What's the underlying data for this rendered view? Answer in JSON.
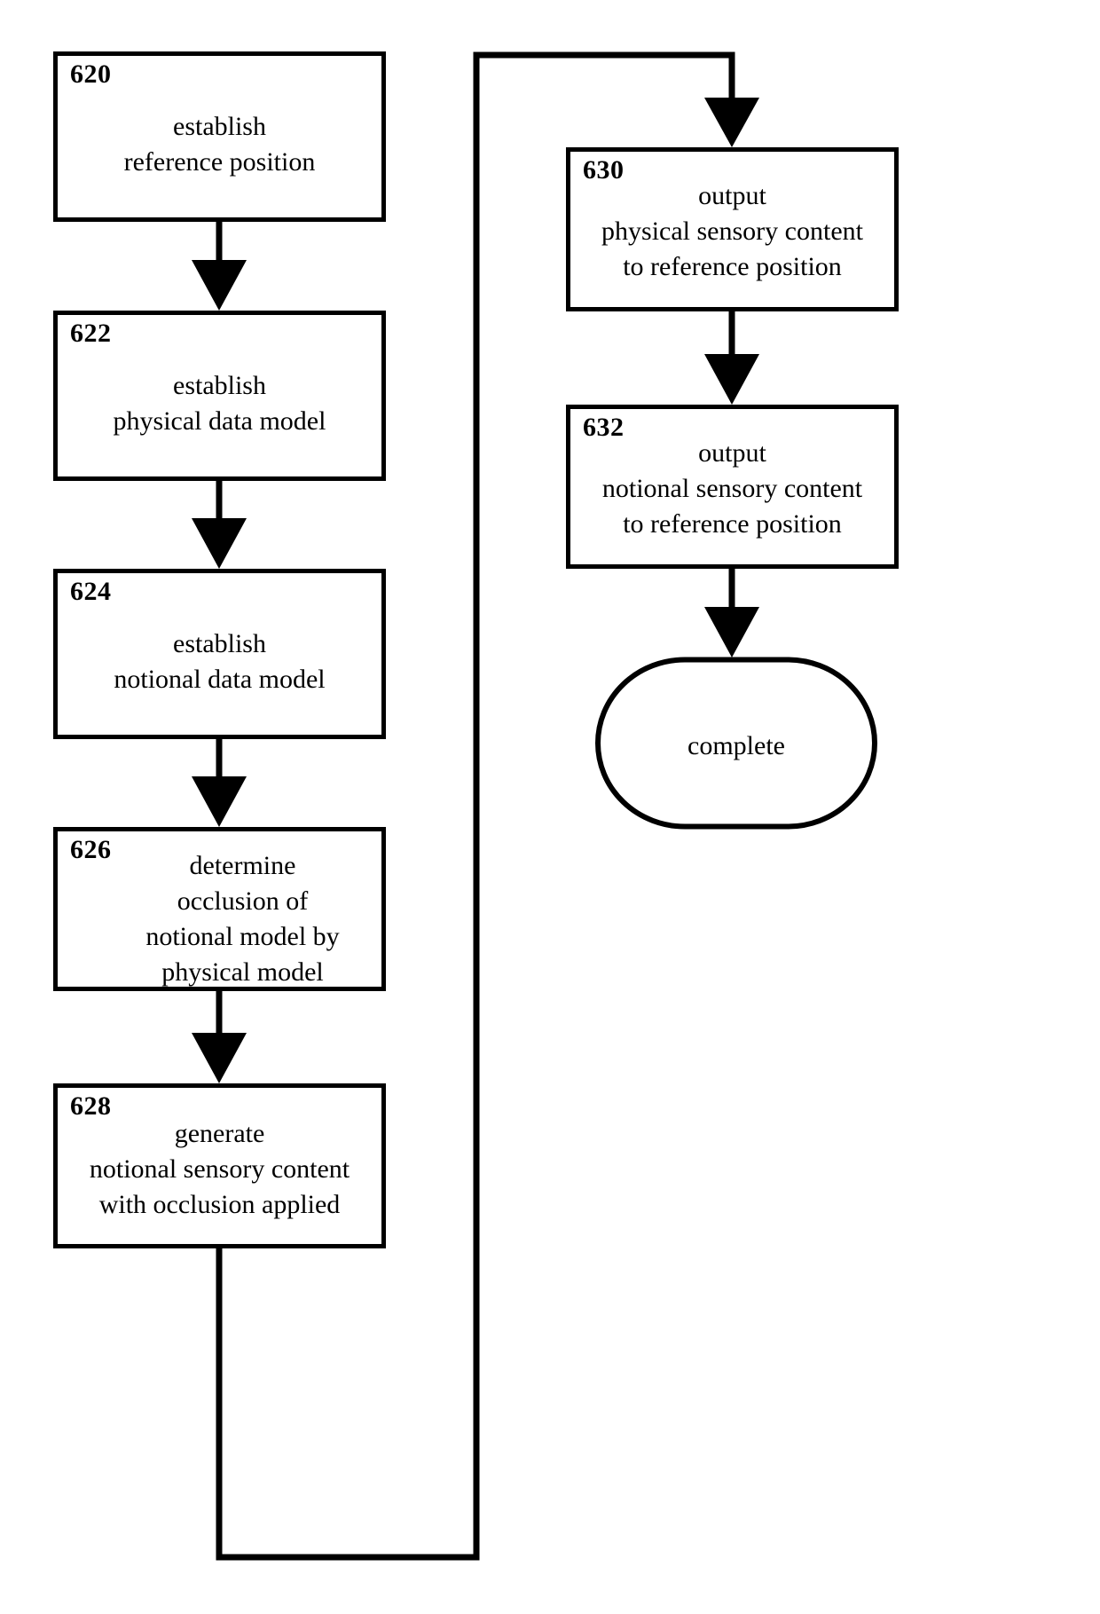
{
  "diagram": {
    "title": "",
    "stroke_color": "#000000",
    "background_color": "#ffffff",
    "nodes": [
      {
        "ref": "620",
        "text": "establish\nreference position",
        "shape": "rect"
      },
      {
        "ref": "622",
        "text": "establish\nphysical data model",
        "shape": "rect"
      },
      {
        "ref": "624",
        "text": "establish\nnotional data model",
        "shape": "rect"
      },
      {
        "ref": "626",
        "text": "determine\nocclusion of\nnotional model by\nphysical model",
        "shape": "rect"
      },
      {
        "ref": "628",
        "text": "generate\nnotional sensory content\nwith occlusion applied",
        "shape": "rect"
      },
      {
        "ref": "630",
        "text": "output\nphysical sensory content\nto reference position",
        "shape": "rect"
      },
      {
        "ref": "632",
        "text": "output\nnotional sensory content\nto reference position",
        "shape": "rect"
      }
    ],
    "terminal": {
      "text": "complete",
      "shape": "stadium"
    },
    "edges": [
      {
        "from": "620",
        "to": "622",
        "type": "arrow"
      },
      {
        "from": "622",
        "to": "624",
        "type": "arrow"
      },
      {
        "from": "624",
        "to": "626",
        "type": "arrow"
      },
      {
        "from": "626",
        "to": "628",
        "type": "arrow"
      },
      {
        "from": "628",
        "to": "630",
        "type": "routed-arrow"
      },
      {
        "from": "630",
        "to": "632",
        "type": "arrow"
      },
      {
        "from": "632",
        "to": "complete",
        "type": "arrow"
      }
    ]
  }
}
